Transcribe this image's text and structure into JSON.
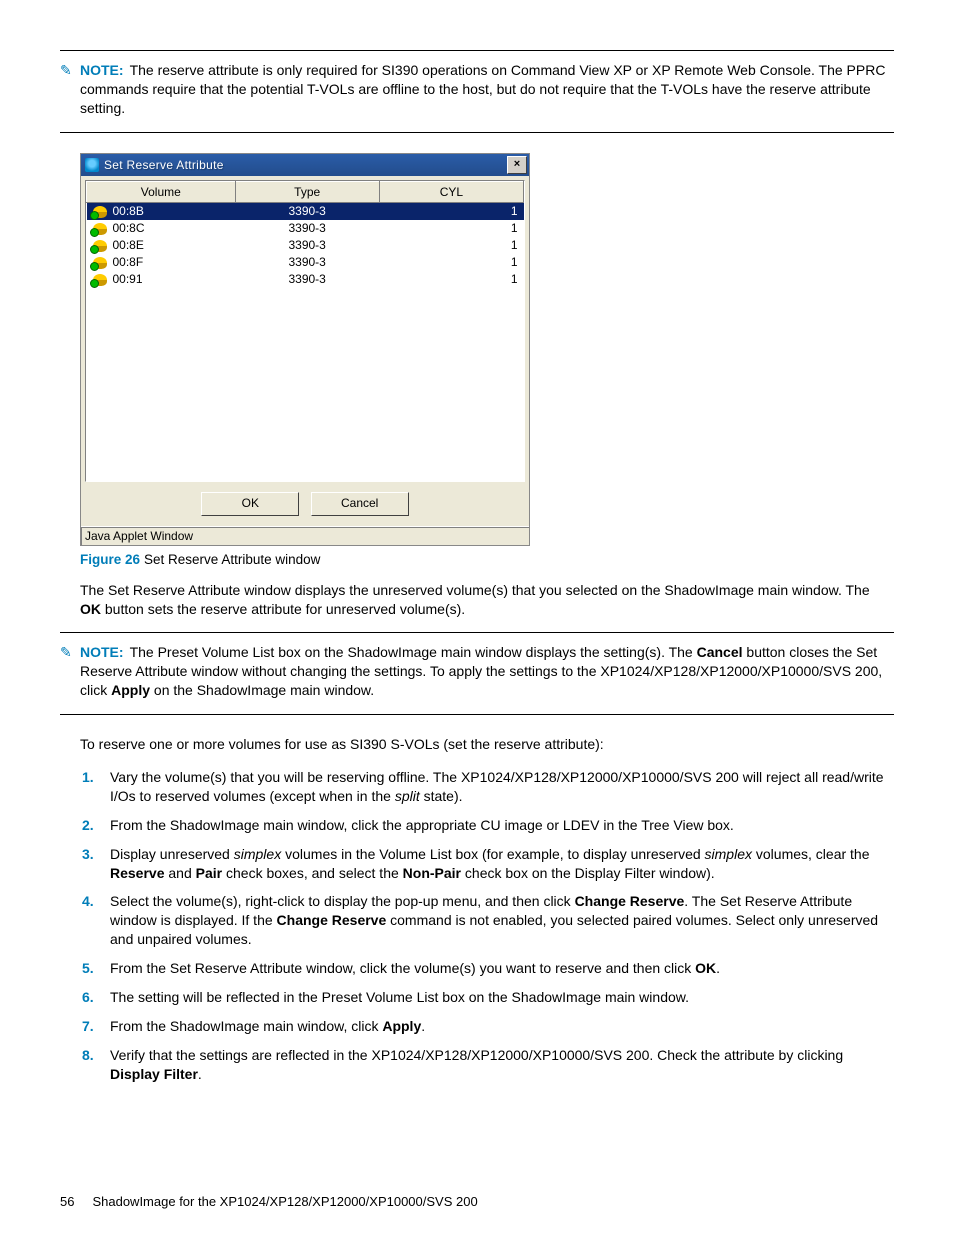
{
  "note1": {
    "label": "NOTE:",
    "text_a": "The reserve attribute is only required for SI390 operations on Command View XP or XP Remote Web Console. The PPRC commands require that the potential T-VOLs are offline to the host, but do not require that the T-VOLs have the reserve attribute setting."
  },
  "dialog": {
    "title": "Set Reserve Attribute",
    "close": "×",
    "cols": {
      "volume": "Volume",
      "type": "Type",
      "cyl": "CYL"
    },
    "rows": [
      {
        "vol": "00:8B",
        "type": "3390-3",
        "cyl": "1",
        "selected": true
      },
      {
        "vol": "00:8C",
        "type": "3390-3",
        "cyl": "1",
        "selected": false
      },
      {
        "vol": "00:8E",
        "type": "3390-3",
        "cyl": "1",
        "selected": false
      },
      {
        "vol": "00:8F",
        "type": "3390-3",
        "cyl": "1",
        "selected": false
      },
      {
        "vol": "00:91",
        "type": "3390-3",
        "cyl": "1",
        "selected": false
      }
    ],
    "ok": "OK",
    "cancel": "Cancel",
    "status": "Java Applet Window"
  },
  "figure": {
    "num": "Figure 26",
    "caption": "Set Reserve Attribute window"
  },
  "para_after_fig_a": "The Set Reserve Attribute window displays the unreserved volume(s) that you selected on the ShadowImage main window. The ",
  "para_after_fig_b": "OK",
  "para_after_fig_c": " button sets the reserve attribute for unreserved volume(s).",
  "note2": {
    "label": "NOTE:",
    "a": "The Preset Volume List box on the ShadowImage main window displays the setting(s). The ",
    "b": "Cancel",
    "c": " button closes the Set Reserve Attribute window without changing the settings. To apply the settings to the XP1024/XP128/XP12000/XP10000/SVS 200, click ",
    "d": "Apply",
    "e": " on the ShadowImage main window."
  },
  "intro": "To reserve one or more volumes for use as SI390 S-VOLs (set the reserve attribute):",
  "steps": {
    "s1a": "Vary the volume(s) that you will be reserving offline. The XP1024/XP128/XP12000/XP10000/SVS 200 will reject all read/write I/Os to reserved volumes (except when in the ",
    "s1b": "split",
    "s1c": " state).",
    "s2": "From the ShadowImage main window, click the appropriate CU image or LDEV in the Tree View box.",
    "s3a": "Display unreserved ",
    "s3b": "simplex",
    "s3c": " volumes in the Volume List box (for example, to display unreserved ",
    "s3d": "simplex",
    "s3e": " volumes, clear the ",
    "s3f": "Reserve",
    "s3g": " and ",
    "s3h": "Pair",
    "s3i": " check boxes, and select the ",
    "s3j": "Non-Pair",
    "s3k": " check box on the Display Filter window).",
    "s4a": "Select the volume(s), right-click to display the pop-up menu, and then click ",
    "s4b": "Change Reserve",
    "s4c": ". The Set Reserve Attribute window is displayed. If the ",
    "s4d": "Change Reserve",
    "s4e": " command is not enabled, you selected paired volumes. Select only unreserved and unpaired volumes.",
    "s5a": "From the Set Reserve Attribute window, click the volume(s) you want to reserve and then click ",
    "s5b": "OK",
    "s5c": ".",
    "s6": "The setting will be reflected in the Preset Volume List box on the ShadowImage main window.",
    "s7a": "From the ShadowImage main window, click ",
    "s7b": "Apply",
    "s7c": ".",
    "s8a": "Verify that the settings are reflected in the XP1024/XP128/XP12000/XP10000/SVS 200. Check the attribute by clicking ",
    "s8b": "Display Filter",
    "s8c": "."
  },
  "footer": {
    "pagenum": "56",
    "doctitle": "ShadowImage for the XP1024/XP128/XP12000/XP10000/SVS 200"
  }
}
